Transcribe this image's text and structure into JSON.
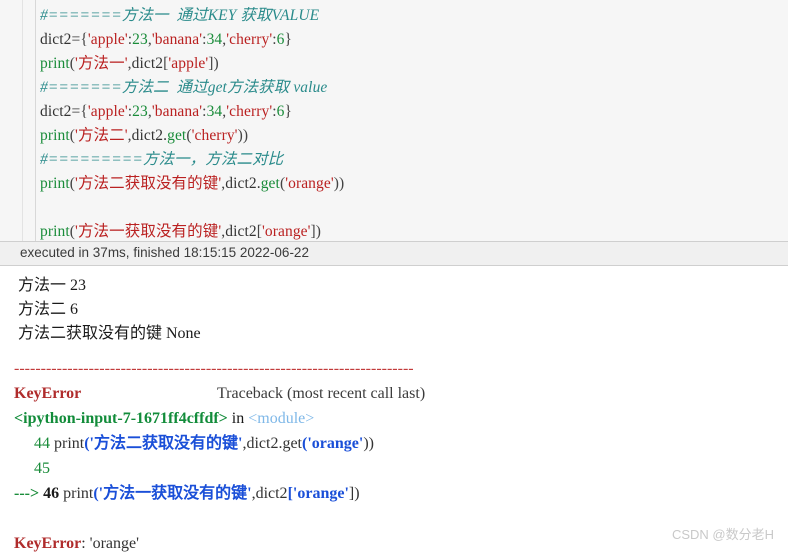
{
  "cell": {
    "lines": [
      {
        "id": "c1",
        "segments": [
          {
            "cls": "cm",
            "t": "#=======方法一  通过KEY 获取VALUE"
          }
        ]
      },
      {
        "id": "c2",
        "segments": [
          {
            "cls": "pl",
            "t": "dict2="
          },
          {
            "cls": "op",
            "t": "{"
          },
          {
            "cls": "st",
            "t": "'apple'"
          },
          {
            "cls": "op",
            "t": ":"
          },
          {
            "cls": "nu",
            "t": "23"
          },
          {
            "cls": "op",
            "t": ","
          },
          {
            "cls": "st",
            "t": "'banana'"
          },
          {
            "cls": "op",
            "t": ":"
          },
          {
            "cls": "nu",
            "t": "34"
          },
          {
            "cls": "op",
            "t": ","
          },
          {
            "cls": "st",
            "t": "'cherry'"
          },
          {
            "cls": "op",
            "t": ":"
          },
          {
            "cls": "nu",
            "t": "6"
          },
          {
            "cls": "op",
            "t": "}"
          }
        ]
      },
      {
        "id": "c3",
        "segments": [
          {
            "cls": "bi",
            "t": "print"
          },
          {
            "cls": "op",
            "t": "("
          },
          {
            "cls": "st",
            "t": "'方法一'"
          },
          {
            "cls": "op",
            "t": ","
          },
          {
            "cls": "pl",
            "t": "dict2"
          },
          {
            "cls": "op",
            "t": "["
          },
          {
            "cls": "st",
            "t": "'apple'"
          },
          {
            "cls": "op",
            "t": "])"
          }
        ]
      },
      {
        "id": "c4",
        "segments": [
          {
            "cls": "cm",
            "t": "#=======方法二  通过get方法获取 value"
          }
        ]
      },
      {
        "id": "c5",
        "segments": [
          {
            "cls": "pl",
            "t": "dict2="
          },
          {
            "cls": "op",
            "t": "{"
          },
          {
            "cls": "st",
            "t": "'apple'"
          },
          {
            "cls": "op",
            "t": ":"
          },
          {
            "cls": "nu",
            "t": "23"
          },
          {
            "cls": "op",
            "t": ","
          },
          {
            "cls": "st",
            "t": "'banana'"
          },
          {
            "cls": "op",
            "t": ":"
          },
          {
            "cls": "nu",
            "t": "34"
          },
          {
            "cls": "op",
            "t": ","
          },
          {
            "cls": "st",
            "t": "'cherry'"
          },
          {
            "cls": "op",
            "t": ":"
          },
          {
            "cls": "nu",
            "t": "6"
          },
          {
            "cls": "op",
            "t": "}"
          }
        ]
      },
      {
        "id": "c6",
        "segments": [
          {
            "cls": "bi",
            "t": "print"
          },
          {
            "cls": "op",
            "t": "("
          },
          {
            "cls": "st",
            "t": "'方法二'"
          },
          {
            "cls": "op",
            "t": ","
          },
          {
            "cls": "pl",
            "t": "dict2."
          },
          {
            "cls": "bi",
            "t": "get"
          },
          {
            "cls": "op",
            "t": "("
          },
          {
            "cls": "st",
            "t": "'cherry'"
          },
          {
            "cls": "op",
            "t": "))"
          }
        ]
      },
      {
        "id": "c7",
        "segments": [
          {
            "cls": "cm",
            "t": "#=========方法一，方法二对比"
          }
        ]
      },
      {
        "id": "c8",
        "segments": [
          {
            "cls": "bi",
            "t": "print"
          },
          {
            "cls": "op",
            "t": "("
          },
          {
            "cls": "st",
            "t": "'方法二获取没有的键'"
          },
          {
            "cls": "op",
            "t": ","
          },
          {
            "cls": "pl",
            "t": "dict2."
          },
          {
            "cls": "bi",
            "t": "get"
          },
          {
            "cls": "op",
            "t": "("
          },
          {
            "cls": "st",
            "t": "'orange'"
          },
          {
            "cls": "op",
            "t": "))"
          }
        ]
      },
      {
        "id": "c9",
        "segments": [
          {
            "cls": "pl",
            "t": ""
          }
        ]
      },
      {
        "id": "c10",
        "segments": [
          {
            "cls": "bi",
            "t": "print"
          },
          {
            "cls": "op",
            "t": "("
          },
          {
            "cls": "st",
            "t": "'方法一获取没有的键'"
          },
          {
            "cls": "op",
            "t": ","
          },
          {
            "cls": "pl",
            "t": "dict2"
          },
          {
            "cls": "op",
            "t": "["
          },
          {
            "cls": "st",
            "t": "'orange'"
          },
          {
            "cls": "op",
            "t": "])"
          }
        ]
      }
    ]
  },
  "statusbar": {
    "text": "executed in 37ms, finished 18:15:15 2022-06-22"
  },
  "stdout": {
    "lines": [
      "方法一 23",
      "方法二 6",
      "方法二获取没有的键 None"
    ]
  },
  "traceback": {
    "separator": "---------------------------------------------------------------------------",
    "lines": [
      {
        "id": "t1",
        "segments": [
          {
            "cls": "err",
            "t": "KeyError"
          },
          {
            "cls": "tbhdr",
            "t": "                                  Traceback (most recent call last)"
          }
        ]
      },
      {
        "id": "t2",
        "segments": [
          {
            "cls": "fileref",
            "t": "<ipython-input-7-1671ff4cffdf>"
          },
          {
            "cls": "inw",
            "t": " in "
          },
          {
            "cls": "modname",
            "t": "<module>"
          }
        ]
      },
      {
        "id": "t3",
        "segments": [
          {
            "cls": "lnum",
            "t": "     44 "
          },
          {
            "cls": "tbplain",
            "t": "print"
          },
          {
            "cls": "tbstr",
            "t": "('方法二获取没有的键'"
          },
          {
            "cls": "tbplain",
            "t": ",dict2."
          },
          {
            "cls": "tbplain",
            "t": "get"
          },
          {
            "cls": "tbstr",
            "t": "('orange'"
          },
          {
            "cls": "tbplain",
            "t": "))"
          }
        ]
      },
      {
        "id": "t4",
        "segments": [
          {
            "cls": "lnum",
            "t": "     45"
          }
        ]
      },
      {
        "id": "t5",
        "segments": [
          {
            "cls": "arrow",
            "t": "---> "
          },
          {
            "cls": "lnum-hit",
            "t": "46 "
          },
          {
            "cls": "tbplain",
            "t": "print"
          },
          {
            "cls": "tbstr",
            "t": "('方法一获取没有的键'"
          },
          {
            "cls": "tbplain",
            "t": ",dict2"
          },
          {
            "cls": "tbstr",
            "t": "['orange'"
          },
          {
            "cls": "tbplain",
            "t": "])"
          }
        ]
      },
      {
        "id": "t6",
        "segments": [
          {
            "cls": "tbplain",
            "t": ""
          }
        ]
      },
      {
        "id": "t7",
        "segments": [
          {
            "cls": "err",
            "t": "KeyError"
          },
          {
            "cls": "errmsg",
            "t": ": 'orange'"
          }
        ]
      }
    ]
  },
  "watermark": {
    "text": "CSDN @数分老H"
  }
}
